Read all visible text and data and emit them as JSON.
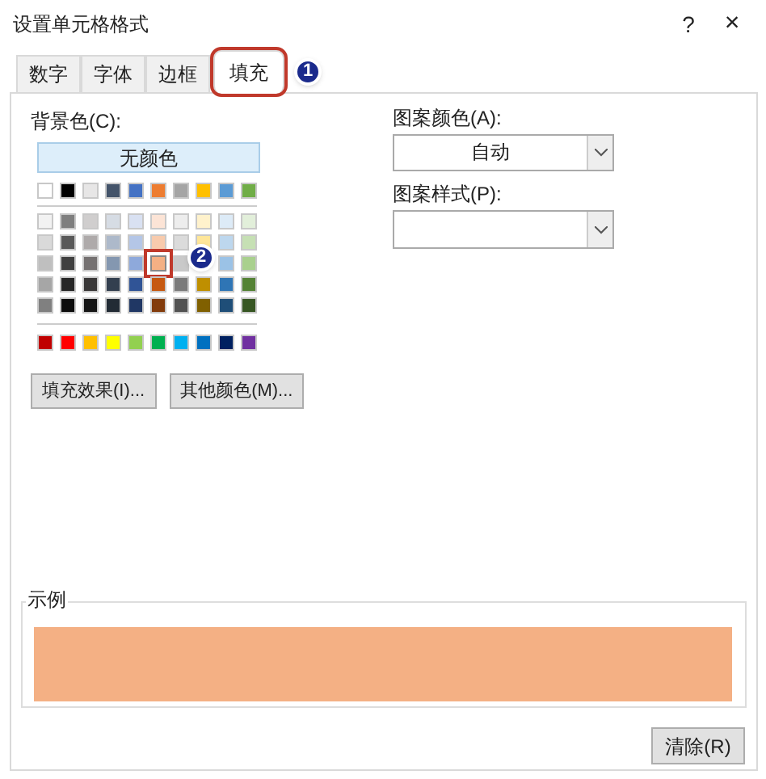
{
  "window": {
    "title": "设置单元格格式",
    "help": "?",
    "close": "×"
  },
  "tabs": [
    {
      "label": "数字",
      "selected": false
    },
    {
      "label": "字体",
      "selected": false
    },
    {
      "label": "边框",
      "selected": false
    },
    {
      "label": "填充",
      "selected": true
    }
  ],
  "background": {
    "label": "背景色(C):",
    "no_color_button": "无颜色",
    "theme_row": [
      {
        "color": "#ffffff",
        "selected": false
      },
      {
        "color": "#000000",
        "selected": false
      },
      {
        "color": "#e7e6e6",
        "selected": false
      },
      {
        "color": "#44546a",
        "selected": false
      },
      {
        "color": "#4472c4",
        "selected": false
      },
      {
        "color": "#ed7d31",
        "selected": false
      },
      {
        "color": "#a5a5a5",
        "selected": false
      },
      {
        "color": "#ffc000",
        "selected": false
      },
      {
        "color": "#5b9bd5",
        "selected": false
      },
      {
        "color": "#70ad47",
        "selected": false
      }
    ],
    "tint_rows": [
      [
        {
          "color": "#f2f2f2",
          "selected": false
        },
        {
          "color": "#7f7f7f",
          "selected": false
        },
        {
          "color": "#d0cece",
          "selected": false
        },
        {
          "color": "#d6dce4",
          "selected": false
        },
        {
          "color": "#d9e1f2",
          "selected": false
        },
        {
          "color": "#fce4d6",
          "selected": false
        },
        {
          "color": "#ededed",
          "selected": false
        },
        {
          "color": "#fff2cc",
          "selected": false
        },
        {
          "color": "#ddebf7",
          "selected": false
        },
        {
          "color": "#e2efda",
          "selected": false
        }
      ],
      [
        {
          "color": "#d9d9d9",
          "selected": false
        },
        {
          "color": "#595959",
          "selected": false
        },
        {
          "color": "#aeaaaa",
          "selected": false
        },
        {
          "color": "#adb9ca",
          "selected": false
        },
        {
          "color": "#b4c6e7",
          "selected": false
        },
        {
          "color": "#f8cbad",
          "selected": false
        },
        {
          "color": "#dbdbdb",
          "selected": false
        },
        {
          "color": "#ffe699",
          "selected": false
        },
        {
          "color": "#bdd7ee",
          "selected": false
        },
        {
          "color": "#c6e0b4",
          "selected": false
        }
      ],
      [
        {
          "color": "#bfbfbf",
          "selected": false
        },
        {
          "color": "#404040",
          "selected": false
        },
        {
          "color": "#757171",
          "selected": false
        },
        {
          "color": "#8497b0",
          "selected": false
        },
        {
          "color": "#8ea9db",
          "selected": false
        },
        {
          "color": "#f4b084",
          "selected": true
        },
        {
          "color": "#c9c9c9",
          "selected": false
        },
        {
          "kind": "covered"
        },
        {
          "color": "#9bc2e6",
          "selected": false
        },
        {
          "color": "#a9d08e",
          "selected": false
        }
      ],
      [
        {
          "color": "#a6a6a6",
          "selected": false
        },
        {
          "color": "#262626",
          "selected": false
        },
        {
          "color": "#3a3838",
          "selected": false
        },
        {
          "color": "#333f4f",
          "selected": false
        },
        {
          "color": "#305496",
          "selected": false
        },
        {
          "color": "#c65911",
          "selected": false
        },
        {
          "color": "#7b7b7b",
          "selected": false
        },
        {
          "color": "#bf8f00",
          "selected": false
        },
        {
          "color": "#2f75b5",
          "selected": false
        },
        {
          "color": "#548235",
          "selected": false
        }
      ],
      [
        {
          "color": "#808080",
          "selected": false
        },
        {
          "color": "#0d0d0d",
          "selected": false
        },
        {
          "color": "#161616",
          "selected": false
        },
        {
          "color": "#222b35",
          "selected": false
        },
        {
          "color": "#203764",
          "selected": false
        },
        {
          "color": "#833c0c",
          "selected": false
        },
        {
          "color": "#525252",
          "selected": false
        },
        {
          "color": "#806000",
          "selected": false
        },
        {
          "color": "#1f4e78",
          "selected": false
        },
        {
          "color": "#375623",
          "selected": false
        }
      ]
    ],
    "standard_row": [
      {
        "color": "#c00000",
        "selected": false
      },
      {
        "color": "#ff0000",
        "selected": false
      },
      {
        "color": "#ffc000",
        "selected": false
      },
      {
        "color": "#ffff00",
        "selected": false
      },
      {
        "color": "#92d050",
        "selected": false
      },
      {
        "color": "#00b050",
        "selected": false
      },
      {
        "color": "#00b0f0",
        "selected": false
      },
      {
        "color": "#0070c0",
        "selected": false
      },
      {
        "color": "#002060",
        "selected": false
      },
      {
        "color": "#7030a0",
        "selected": false
      }
    ],
    "buttons": [
      "填充效果(I)...",
      "其他颜色(M)..."
    ]
  },
  "pattern_color": {
    "label": "图案颜色(A):",
    "value": "自动"
  },
  "pattern_style": {
    "label": "图案样式(P):"
  },
  "sample": {
    "label": "示例",
    "color": "#f4b084"
  },
  "clear_button": "清除(R)",
  "callouts": [
    {
      "label": "1"
    },
    {
      "label": "2"
    }
  ]
}
